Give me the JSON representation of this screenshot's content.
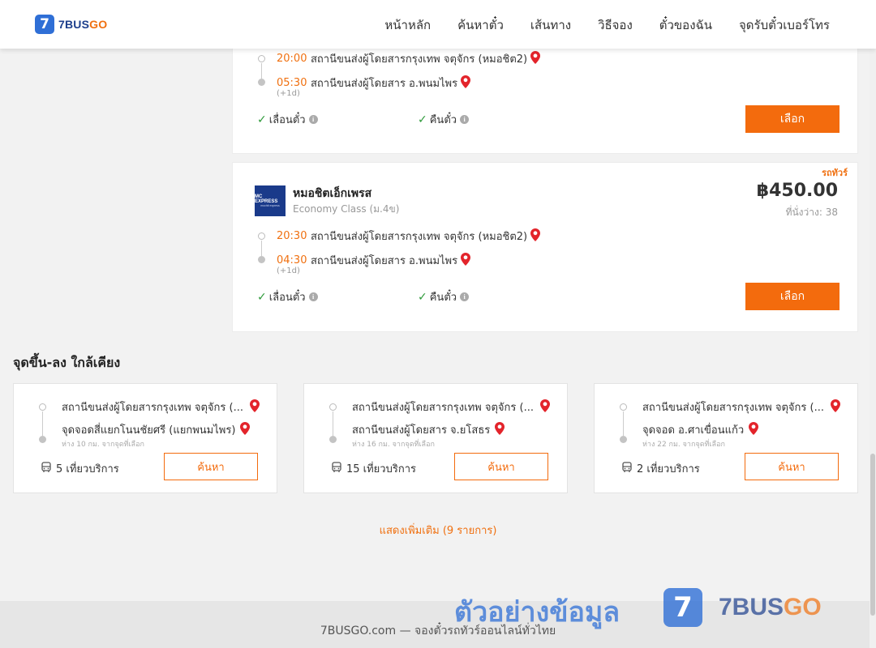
{
  "header": {
    "logo_mark": "7",
    "logo_text_a": "7BUS",
    "logo_text_b": "GO",
    "nav": [
      "หน้าหลัก",
      "ค้นหาตั๋ว",
      "เส้นทาง",
      "วิธีจอง",
      "ตั๋วของฉัน",
      "จุดรับตั๋วเบอร์โทร"
    ]
  },
  "trips": [
    {
      "depart_time": "20:00",
      "depart_station": "สถานีขนส่งผู้โดยสารกรุงเทพ จตุจักร (หมอชิต2)",
      "arrive_time": "05:30",
      "arrive_station": "สถานีขนส่งผู้โดยสาร อ.พนมไพร",
      "next_day": "(+1d)",
      "policy_change": "เลื่อนตั๋ว",
      "policy_refund": "คืนตั๋ว",
      "select_label": "เลือก"
    },
    {
      "badge": "รถทัวร์",
      "operator_logo_text": "MC EXPRESS",
      "operator_logo_sub": "mochit express",
      "operator": "หมอชิตเอ็กเพรส",
      "bus_class": "Economy Class (ม.4ข)",
      "price": "฿450.00",
      "seats": "ที่นั่งว่าง: 38",
      "depart_time": "20:30",
      "depart_station": "สถานีขนส่งผู้โดยสารกรุงเทพ จตุจักร (หมอชิต2)",
      "arrive_time": "04:30",
      "arrive_station": "สถานีขนส่งผู้โดยสาร อ.พนมไพร",
      "next_day": "(+1d)",
      "policy_change": "เลื่อนตั๋ว",
      "policy_refund": "คืนตั๋ว",
      "select_label": "เลือก"
    }
  ],
  "nearby": {
    "title": "จุดขึ้น-ลง ใกล้เคียง",
    "items": [
      {
        "from": "สถานีขนส่งผู้โดยสารกรุงเทพ จตุจักร (...",
        "to": "จุดจอดสี่แยกโนนชัยศรี (แยกพนมไพร)",
        "distance": "ห่าง 10 กม. จากจุดที่เลือก",
        "services": "5 เที่ยวบริการ",
        "button": "ค้นหา"
      },
      {
        "from": "สถานีขนส่งผู้โดยสารกรุงเทพ จตุจักร (...",
        "to": "สถานีขนส่งผู้โดยสาร จ.ยโสธร",
        "distance": "ห่าง 16 กม. จากจุดที่เลือก",
        "services": "15 เที่ยวบริการ",
        "button": "ค้นหา"
      },
      {
        "from": "สถานีขนส่งผู้โดยสารกรุงเทพ จตุจักร (...",
        "to": "จุดจอด อ.ศาเขื่อนแก้ว",
        "distance": "ห่าง 22 กม. จากจุดที่เลือก",
        "services": "2 เที่ยวบริการ",
        "button": "ค้นหา"
      }
    ],
    "show_more": "แสดงเพิ่มเติม (9 รายการ)"
  },
  "footer": {
    "text": "7BUSGO.com — จองตั๋วรถทัวร์ออนไลน์ทั่วไทย",
    "watermark": "ตัวอย่างข้อมูล",
    "watermark_logo_mark": "7",
    "watermark_logo_a": "7BUS",
    "watermark_logo_b": "GO"
  },
  "colors": {
    "accent": "#f36b0d",
    "brand_blue": "#2f6fd6",
    "check_green": "#2e9a3a"
  },
  "icons": [
    "map-pin-icon",
    "check-icon",
    "info-icon",
    "bus-icon"
  ]
}
